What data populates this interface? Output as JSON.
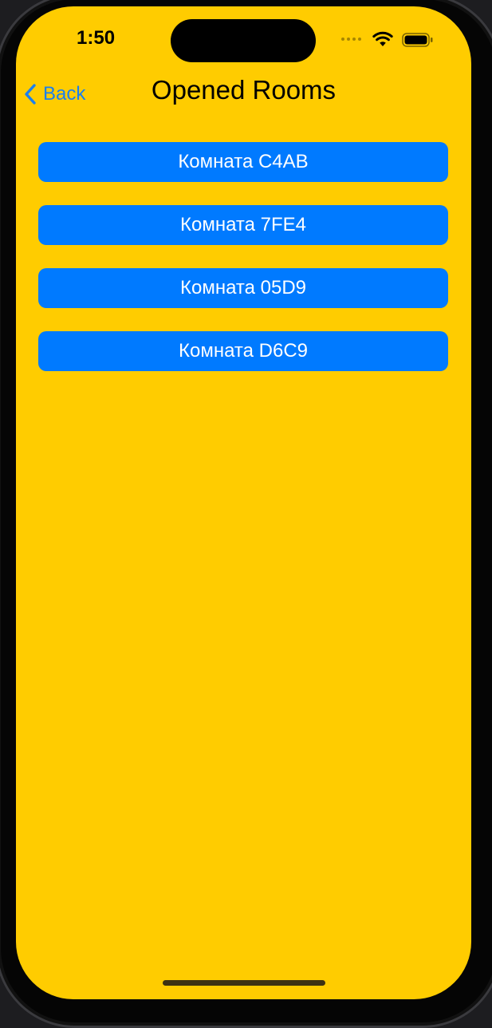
{
  "status_bar": {
    "time": "1:50",
    "wifi_icon": "wifi-icon",
    "battery_icon": "battery-icon"
  },
  "nav": {
    "back_label": "Back",
    "back_icon": "chevron-left-icon",
    "title": "Opened Rooms"
  },
  "rooms": [
    {
      "label": "Комната C4AB"
    },
    {
      "label": "Комната 7FE4"
    },
    {
      "label": "Комната 05D9"
    },
    {
      "label": "Комната D6C9"
    }
  ],
  "colors": {
    "background": "#FFCC00",
    "button": "#007AFF",
    "button_text": "#FFFFFF",
    "back_tint": "#1A7FF0"
  }
}
